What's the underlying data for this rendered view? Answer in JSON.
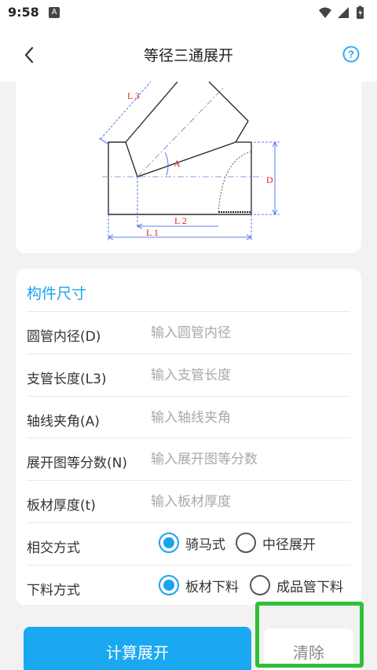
{
  "status": {
    "time": "9:58",
    "badge": "A"
  },
  "header": {
    "title": "等径三通展开",
    "back": "back",
    "help": "?"
  },
  "diagram": {
    "labels": {
      "L3": "L 3",
      "A": "A",
      "D": "D",
      "L2": "L 2",
      "L1": "L 1"
    }
  },
  "form": {
    "section_title": "构件尺寸",
    "fields": [
      {
        "label": "圆管内径(D)",
        "placeholder": "输入圆管内径",
        "value": ""
      },
      {
        "label": "支管长度(L3)",
        "placeholder": "输入支管长度",
        "value": ""
      },
      {
        "label": "轴线夹角(A)",
        "placeholder": "输入轴线夹角",
        "value": ""
      },
      {
        "label": "展开图等分数(N)",
        "placeholder": "输入展开图等分数",
        "value": ""
      },
      {
        "label": "板材厚度(t)",
        "placeholder": "输入板材厚度",
        "value": ""
      }
    ],
    "intersect": {
      "label": "相交方式",
      "options": [
        "骑马式",
        "中径展开"
      ],
      "selected": "骑马式"
    },
    "cutting": {
      "label": "下料方式",
      "options": [
        "板材下料",
        "成品管下料"
      ],
      "selected": "板材下料"
    }
  },
  "buttons": {
    "calculate": "计算展开",
    "clear": "清除"
  },
  "colors": {
    "accent": "#1aa3ec",
    "highlight": "#2fbf3a",
    "diagram_red": "#e02020",
    "diagram_blue": "#3355ee"
  }
}
